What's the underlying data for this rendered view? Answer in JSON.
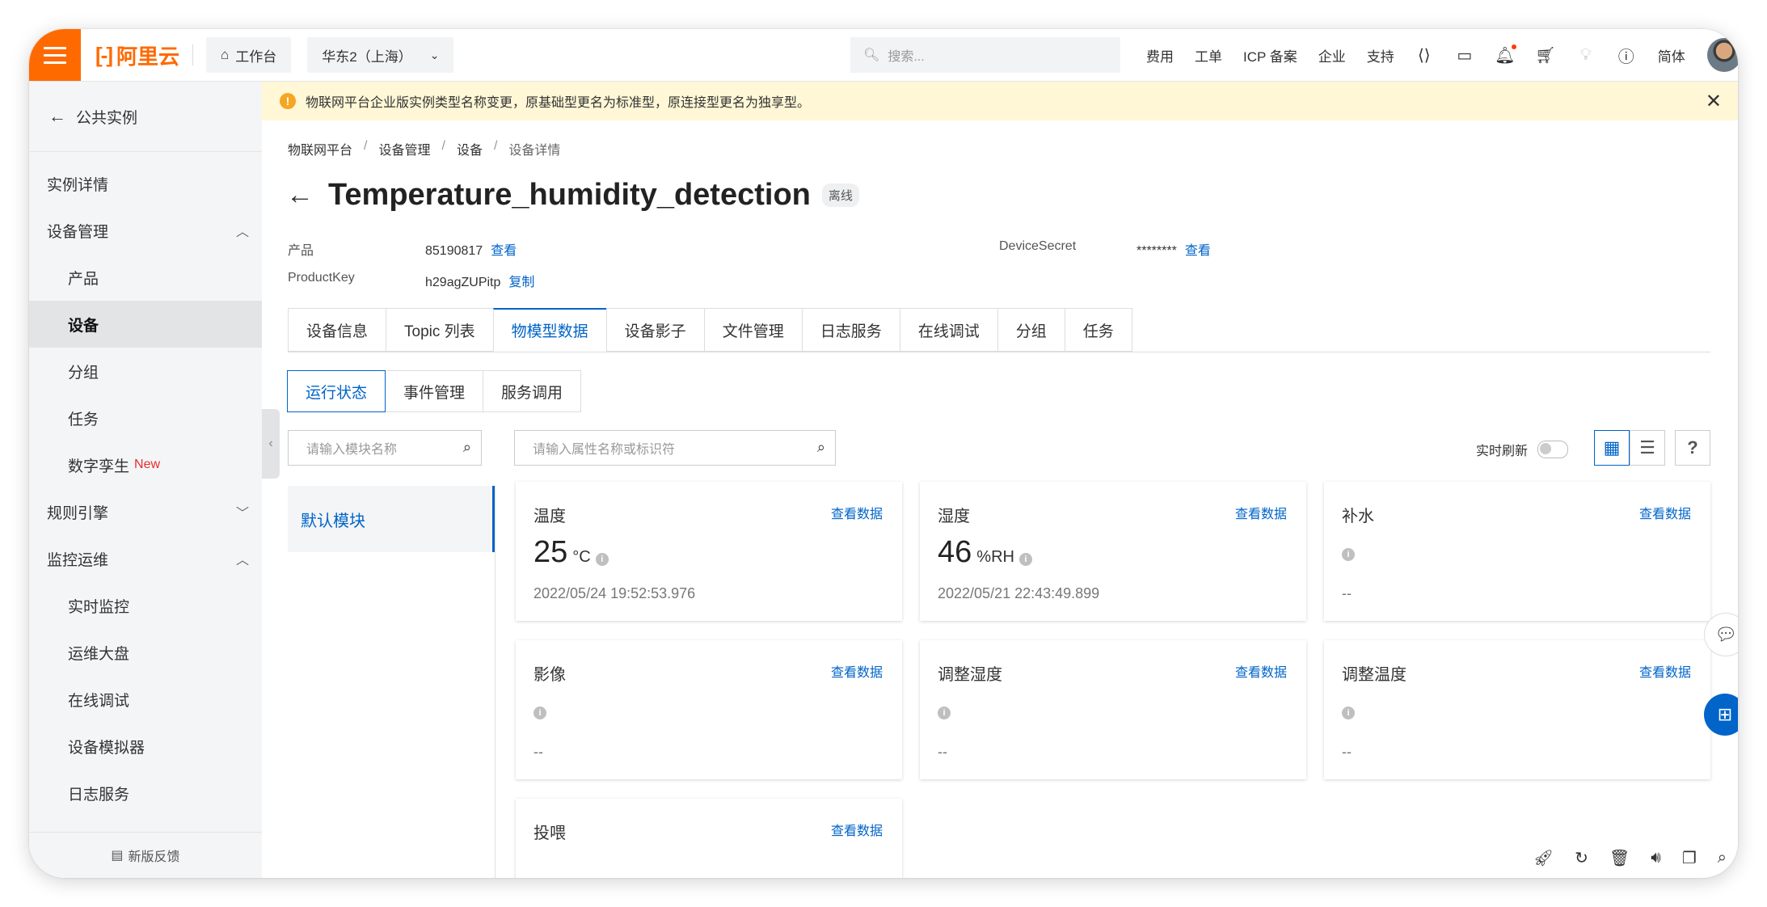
{
  "topbar": {
    "brand": "阿里云",
    "workbench": "工作台",
    "region": "华东2（上海）",
    "search_placeholder": "搜索...",
    "links": [
      "费用",
      "工单",
      "ICP 备案",
      "企业",
      "支持"
    ],
    "lang": "简体"
  },
  "sidebar": {
    "back": "公共实例",
    "items": [
      {
        "label": "实例详情"
      },
      {
        "label": "设备管理"
      },
      {
        "label": "产品"
      },
      {
        "label": "设备"
      },
      {
        "label": "分组"
      },
      {
        "label": "任务"
      },
      {
        "label": "数字孪生",
        "badge": "New"
      },
      {
        "label": "规则引擎"
      },
      {
        "label": "监控运维"
      },
      {
        "label": "实时监控"
      },
      {
        "label": "运维大盘"
      },
      {
        "label": "在线调试"
      },
      {
        "label": "设备模拟器"
      },
      {
        "label": "日志服务"
      }
    ],
    "feedback": "新版反馈"
  },
  "notice": {
    "text": "物联网平台企业版实例类型名称变更，原基础型更名为标准型，原连接型更名为独享型。"
  },
  "breadcrumb": [
    "物联网平台",
    "设备管理",
    "设备",
    "设备详情"
  ],
  "device": {
    "title": "Temperature_humidity_detection",
    "status": "离线",
    "product_label": "产品",
    "product_value": "85190817",
    "product_link": "查看",
    "productkey_label": "ProductKey",
    "productkey_value": "h29agZUPitp",
    "productkey_link": "复制",
    "secret_label": "DeviceSecret",
    "secret_value": "********",
    "secret_link": "查看"
  },
  "tabs": [
    "设备信息",
    "Topic 列表",
    "物模型数据",
    "设备影子",
    "文件管理",
    "日志服务",
    "在线调试",
    "分组",
    "任务"
  ],
  "subtabs": [
    "运行状态",
    "事件管理",
    "服务调用"
  ],
  "module_search_placeholder": "请输入模块名称",
  "prop_search_placeholder": "请输入属性名称或标识符",
  "modules": [
    "默认模块"
  ],
  "realtime_refresh": "实时刷新",
  "help": "?",
  "view_data": "查看数据",
  "cards": [
    {
      "name": "温度",
      "value": "25",
      "unit": "°C",
      "time": "2022/05/24 19:52:53.976"
    },
    {
      "name": "湿度",
      "value": "46",
      "unit": "%RH",
      "time": "2022/05/21 22:43:49.899"
    },
    {
      "name": "补水",
      "value": "",
      "unit": "",
      "time": "--"
    },
    {
      "name": "影像",
      "value": "",
      "unit": "",
      "time": "--"
    },
    {
      "name": "调整湿度",
      "value": "",
      "unit": "",
      "time": "--"
    },
    {
      "name": "调整温度",
      "value": "",
      "unit": "",
      "time": "--"
    },
    {
      "name": "投喂",
      "value": "",
      "unit": "",
      "time": ""
    }
  ]
}
